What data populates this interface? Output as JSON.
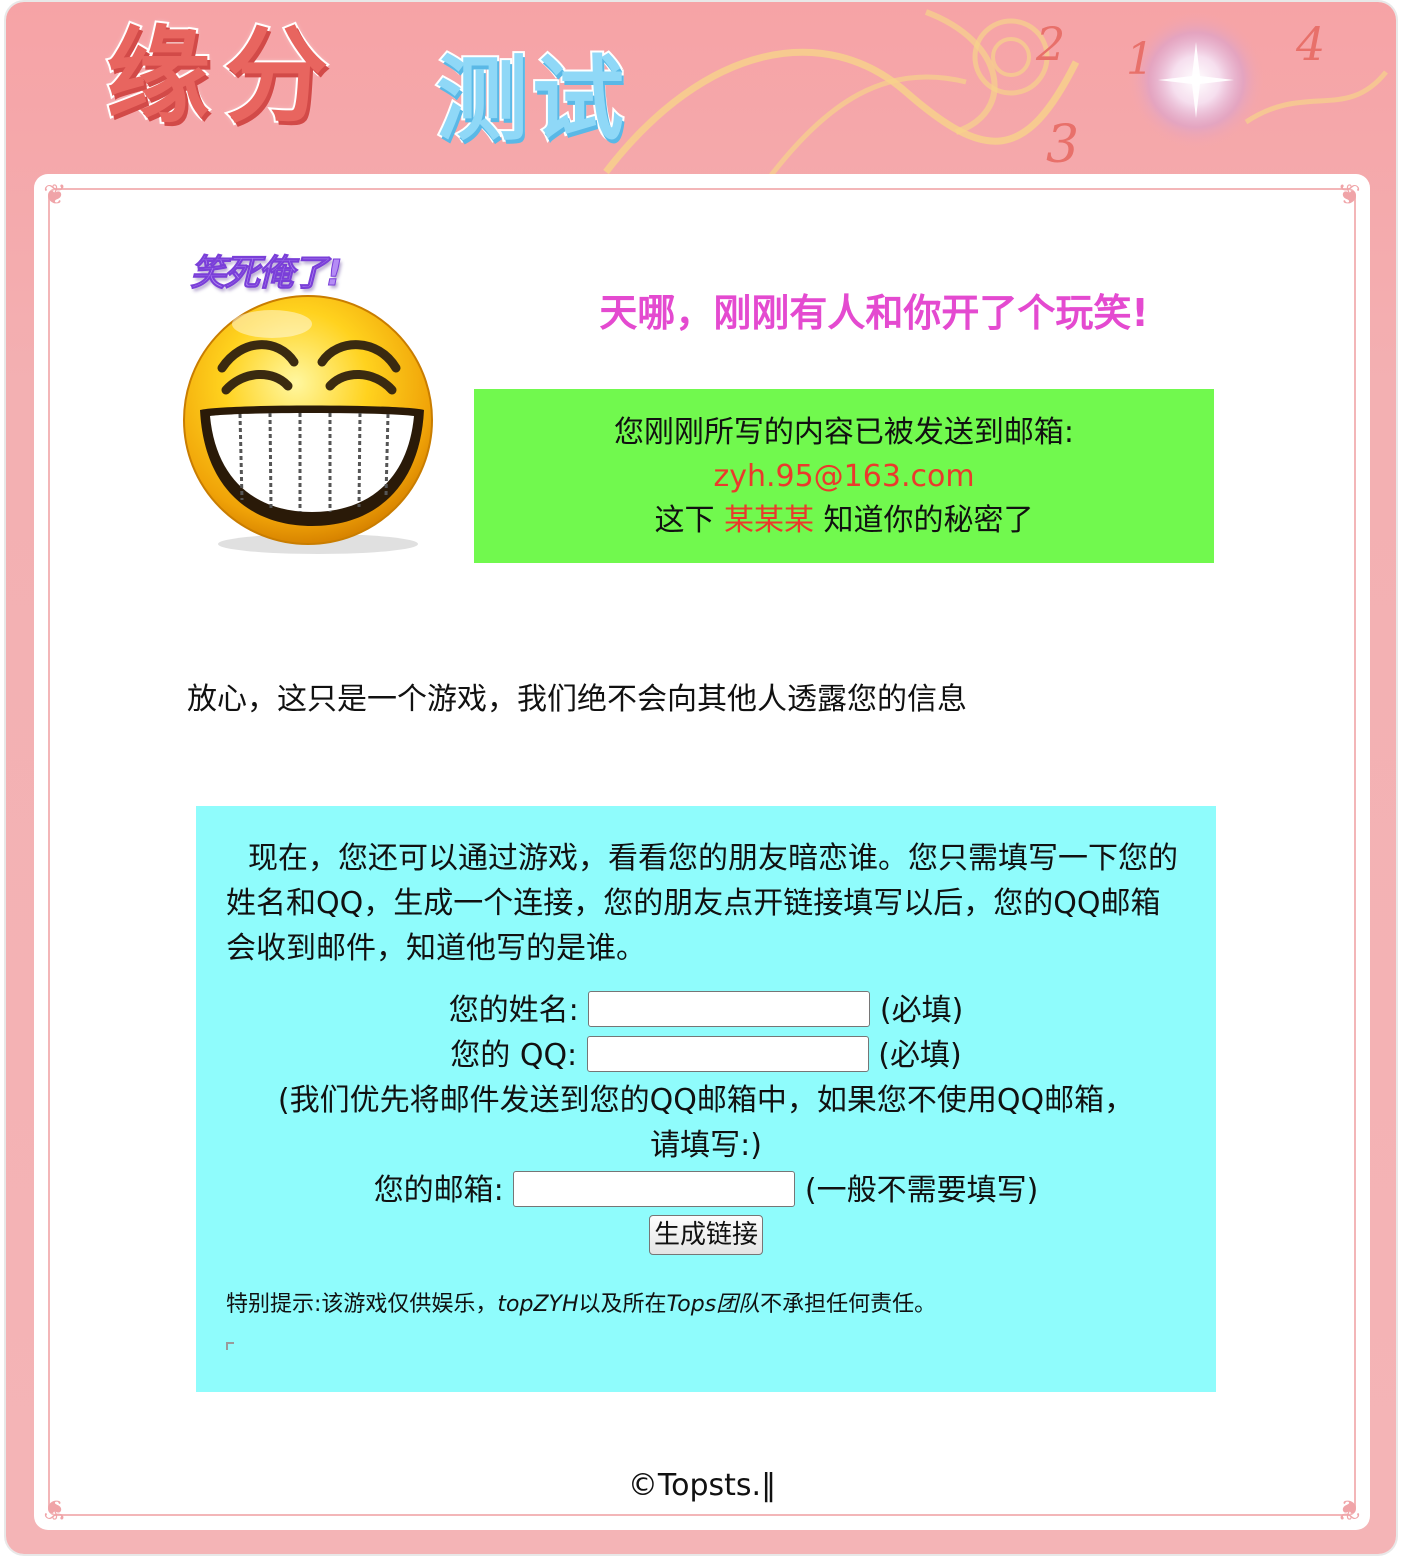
{
  "banner": {
    "title_main": "缘分",
    "title_sub": "测试",
    "deco_numbers": [
      "2",
      "1",
      "4",
      "3"
    ]
  },
  "smiley": {
    "caption": "笑死俺了!",
    "icon": "laughing-face-icon"
  },
  "result": {
    "headline": "天哪，刚刚有人和你开了个玩笑!",
    "sent_label": "您刚刚所写的内容已被发送到邮箱:",
    "email": "zyh.95@163.com",
    "secret_prefix": "这下",
    "secret_name": "某某某",
    "secret_suffix": "知道你的秘密了"
  },
  "reassurance": "放心，这只是一个游戏，我们绝不会向其他人透露您的信息",
  "invite": {
    "intro": "现在，您还可以通过游戏，看看您的朋友暗恋谁。您只需填写一下您的姓名和QQ，生成一个连接，您的朋友点开链接填写以后，您的QQ邮箱会收到邮件，知道他写的是谁。",
    "name_label": "您的姓名:",
    "name_value": "",
    "name_hint": "(必填)",
    "qq_label": "您的 QQ:",
    "qq_value": "",
    "qq_hint": "(必填)",
    "email_note": "(我们优先将邮件发送到您的QQ邮箱中，如果您不使用QQ邮箱，请填写:)",
    "email_label": "您的邮箱:",
    "email_value": "",
    "email_hint": "(一般不需要填写)",
    "submit_label": "生成链接",
    "disclaimer_prefix": "特别提示:该游戏仅供娱乐，",
    "disclaimer_author": "topZYH",
    "disclaimer_mid": "以及所在",
    "disclaimer_team": "Tops团队",
    "disclaimer_suffix": "不承担任何责任。"
  },
  "footer": {
    "copyright": "©Topsts.‖"
  },
  "colors": {
    "frame_pink": "#f4b4b6",
    "headline_magenta": "#e44ad0",
    "green_box": "#71f94e",
    "cyan_box": "#8ffcfc",
    "highlight_red": "#ea3a2c"
  }
}
